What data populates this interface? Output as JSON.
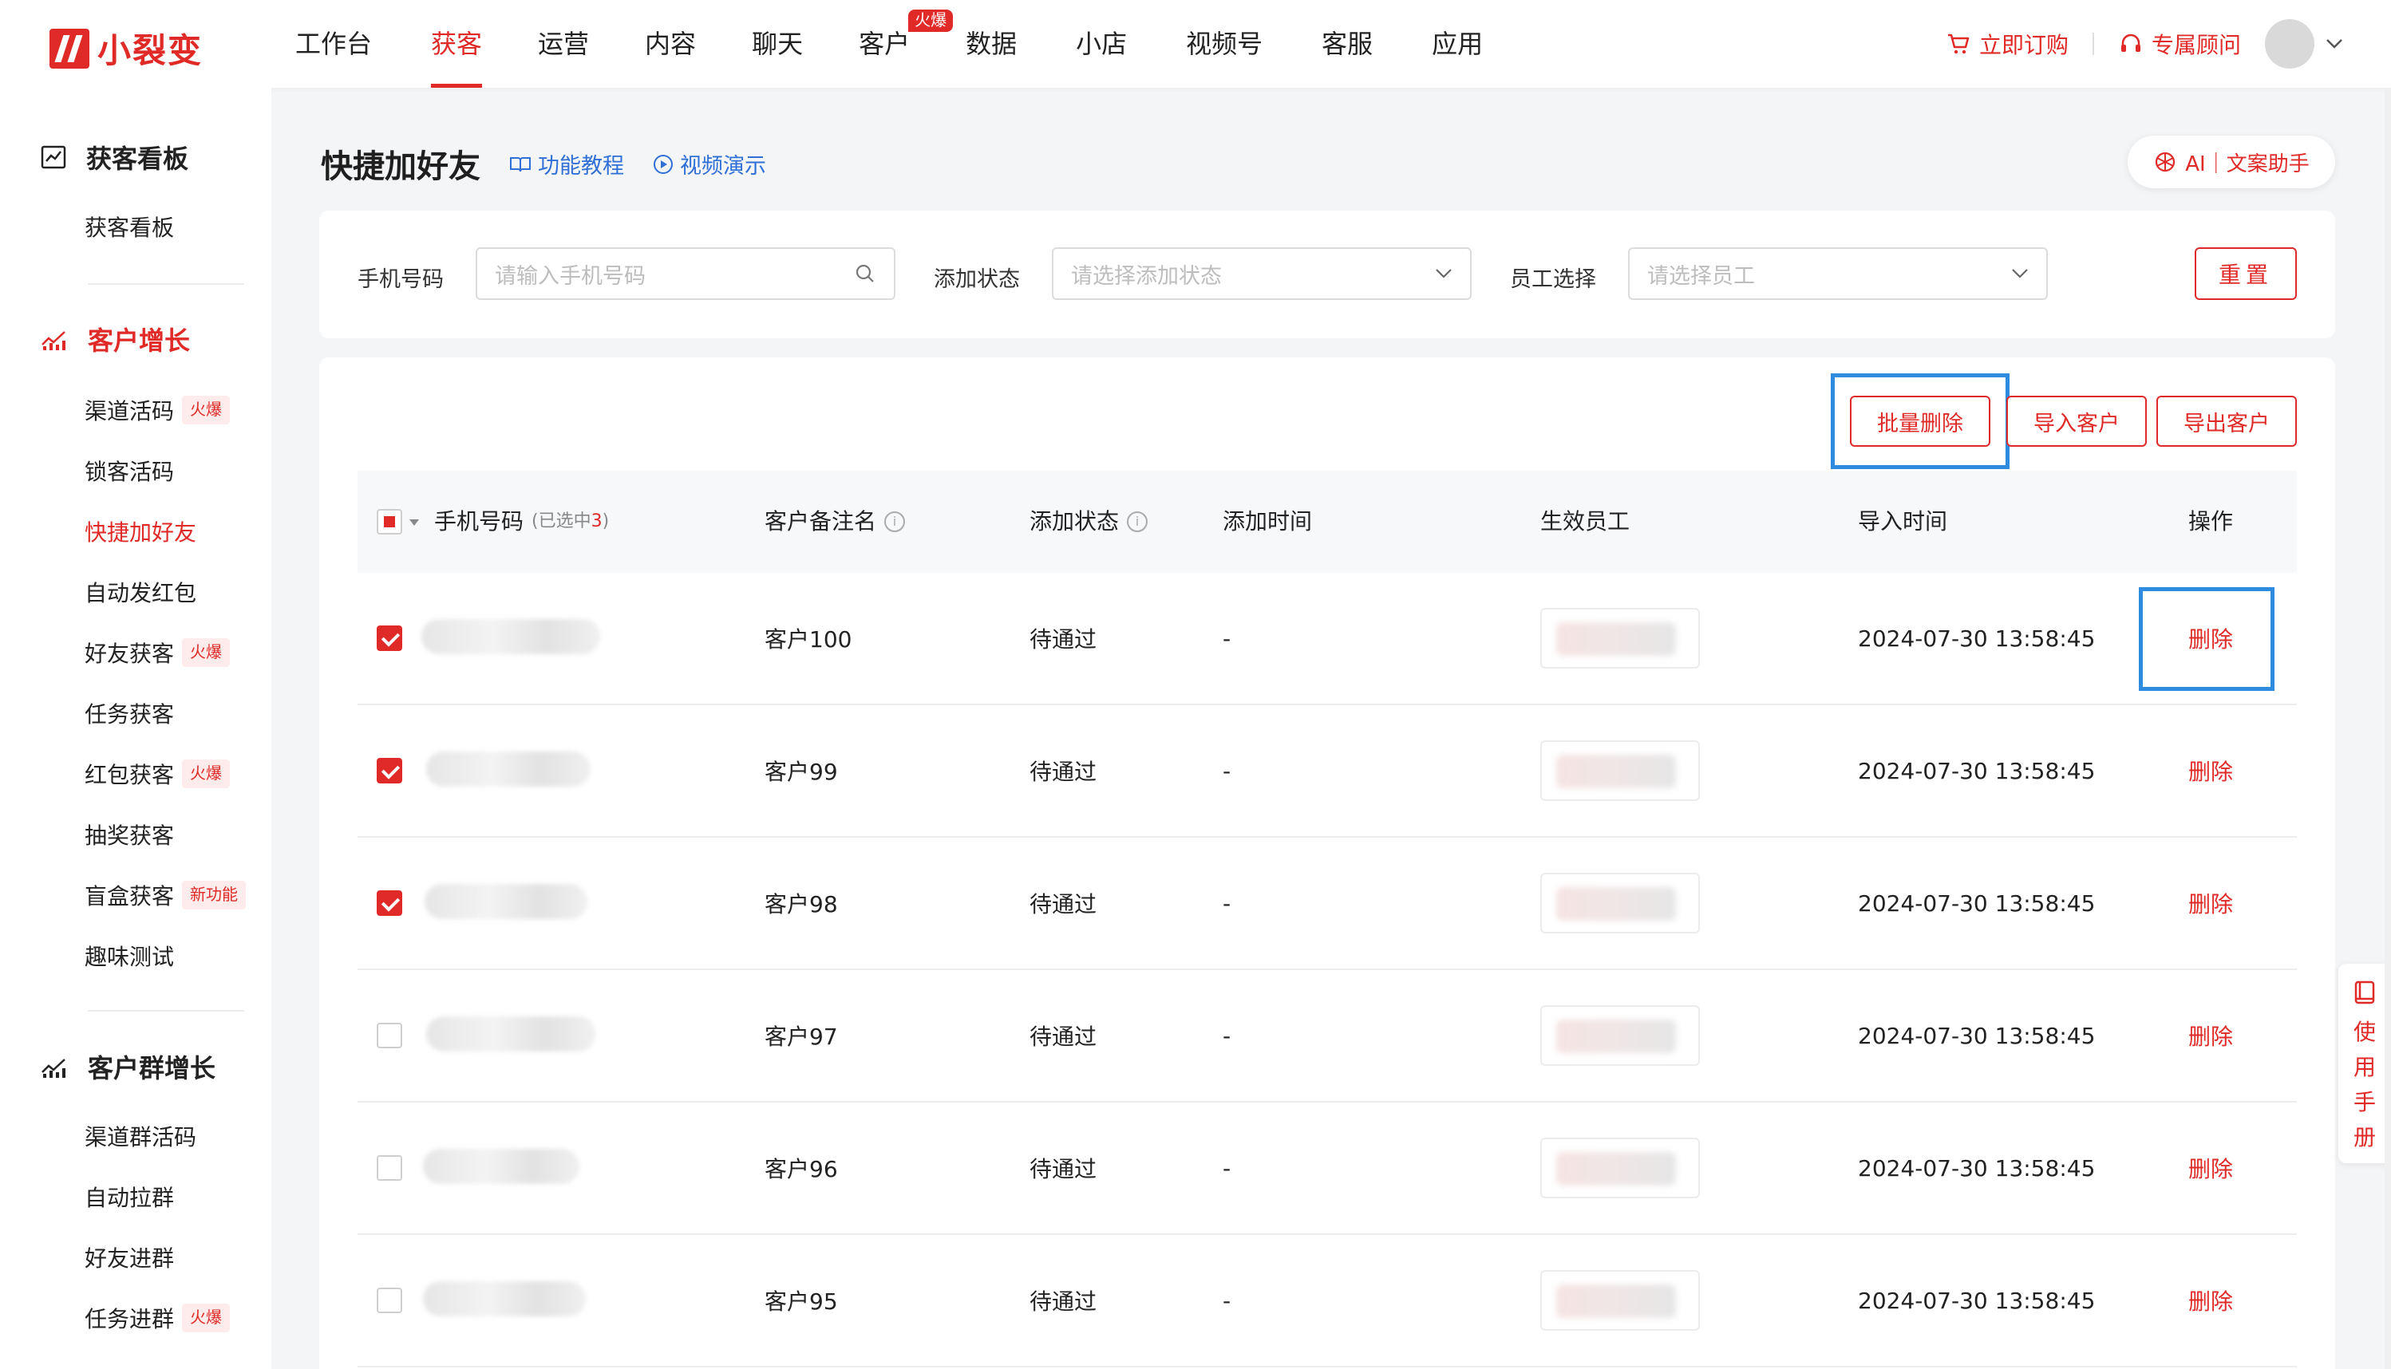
{
  "brand": {
    "name": "小裂变",
    "color": "#e02a27"
  },
  "nav": {
    "items": [
      {
        "label": "工作台"
      },
      {
        "label": "获客",
        "active": true
      },
      {
        "label": "运营"
      },
      {
        "label": "内容"
      },
      {
        "label": "聊天"
      },
      {
        "label": "客户",
        "badge": "火爆"
      },
      {
        "label": "数据"
      },
      {
        "label": "小店"
      },
      {
        "label": "视频号"
      },
      {
        "label": "客服"
      },
      {
        "label": "应用"
      }
    ]
  },
  "top_right": {
    "subscribe": "立即订购",
    "advisor": "专属顾问"
  },
  "sidebar": {
    "groups": [
      {
        "title": "获客看板",
        "items": [
          {
            "label": "获客看板"
          }
        ]
      },
      {
        "title": "客户增长",
        "items": [
          {
            "label": "渠道活码",
            "tag": "火爆"
          },
          {
            "label": "锁客活码"
          },
          {
            "label": "快捷加好友",
            "active": true
          },
          {
            "label": "自动发红包"
          },
          {
            "label": "好友获客",
            "tag": "火爆"
          },
          {
            "label": "任务获客"
          },
          {
            "label": "红包获客",
            "tag": "火爆"
          },
          {
            "label": "抽奖获客"
          },
          {
            "label": "盲盒获客",
            "tag": "新功能"
          },
          {
            "label": "趣味测试"
          }
        ]
      },
      {
        "title": "客户群增长",
        "items": [
          {
            "label": "渠道群活码"
          },
          {
            "label": "自动拉群"
          },
          {
            "label": "好友进群"
          },
          {
            "label": "任务进群",
            "tag": "火爆"
          }
        ]
      }
    ]
  },
  "page": {
    "title": "快捷加好友",
    "tutorial_link": "功能教程",
    "video_link": "视频演示",
    "ai_button": "AI｜文案助手"
  },
  "filters": {
    "phone_label": "手机号码",
    "phone_placeholder": "请输入手机号码",
    "status_label": "添加状态",
    "status_placeholder": "请选择添加状态",
    "staff_label": "员工选择",
    "staff_placeholder": "请选择员工",
    "reset": "重置"
  },
  "actions": {
    "batch_delete": "批量删除",
    "import": "导入客户",
    "export": "导出客户"
  },
  "table": {
    "columns": {
      "phone": "手机号码",
      "selected_prefix": "(已选中",
      "selected_count": "3",
      "selected_suffix": ")",
      "remark": "客户备注名",
      "status": "添加状态",
      "add_time": "添加时间",
      "staff": "生效员工",
      "import_time": "导入时间",
      "op": "操作"
    },
    "rows": [
      {
        "checked": true,
        "remark": "客户100",
        "status": "待通过",
        "add_time": "-",
        "import_time": "2024-07-30 13:58:45",
        "op": "删除"
      },
      {
        "checked": true,
        "remark": "客户99",
        "status": "待通过",
        "add_time": "-",
        "import_time": "2024-07-30 13:58:45",
        "op": "删除"
      },
      {
        "checked": true,
        "remark": "客户98",
        "status": "待通过",
        "add_time": "-",
        "import_time": "2024-07-30 13:58:45",
        "op": "删除"
      },
      {
        "checked": false,
        "remark": "客户97",
        "status": "待通过",
        "add_time": "-",
        "import_time": "2024-07-30 13:58:45",
        "op": "删除"
      },
      {
        "checked": false,
        "remark": "客户96",
        "status": "待通过",
        "add_time": "-",
        "import_time": "2024-07-30 13:58:45",
        "op": "删除"
      },
      {
        "checked": false,
        "remark": "客户95",
        "status": "待通过",
        "add_time": "-",
        "import_time": "2024-07-30 13:58:45",
        "op": "删除"
      }
    ]
  },
  "manual": {
    "chars": [
      "使",
      "用",
      "手",
      "册"
    ]
  },
  "colors": {
    "accent": "#e02a27",
    "link": "#2f6fd6",
    "highlight": "#2d8ce0"
  }
}
